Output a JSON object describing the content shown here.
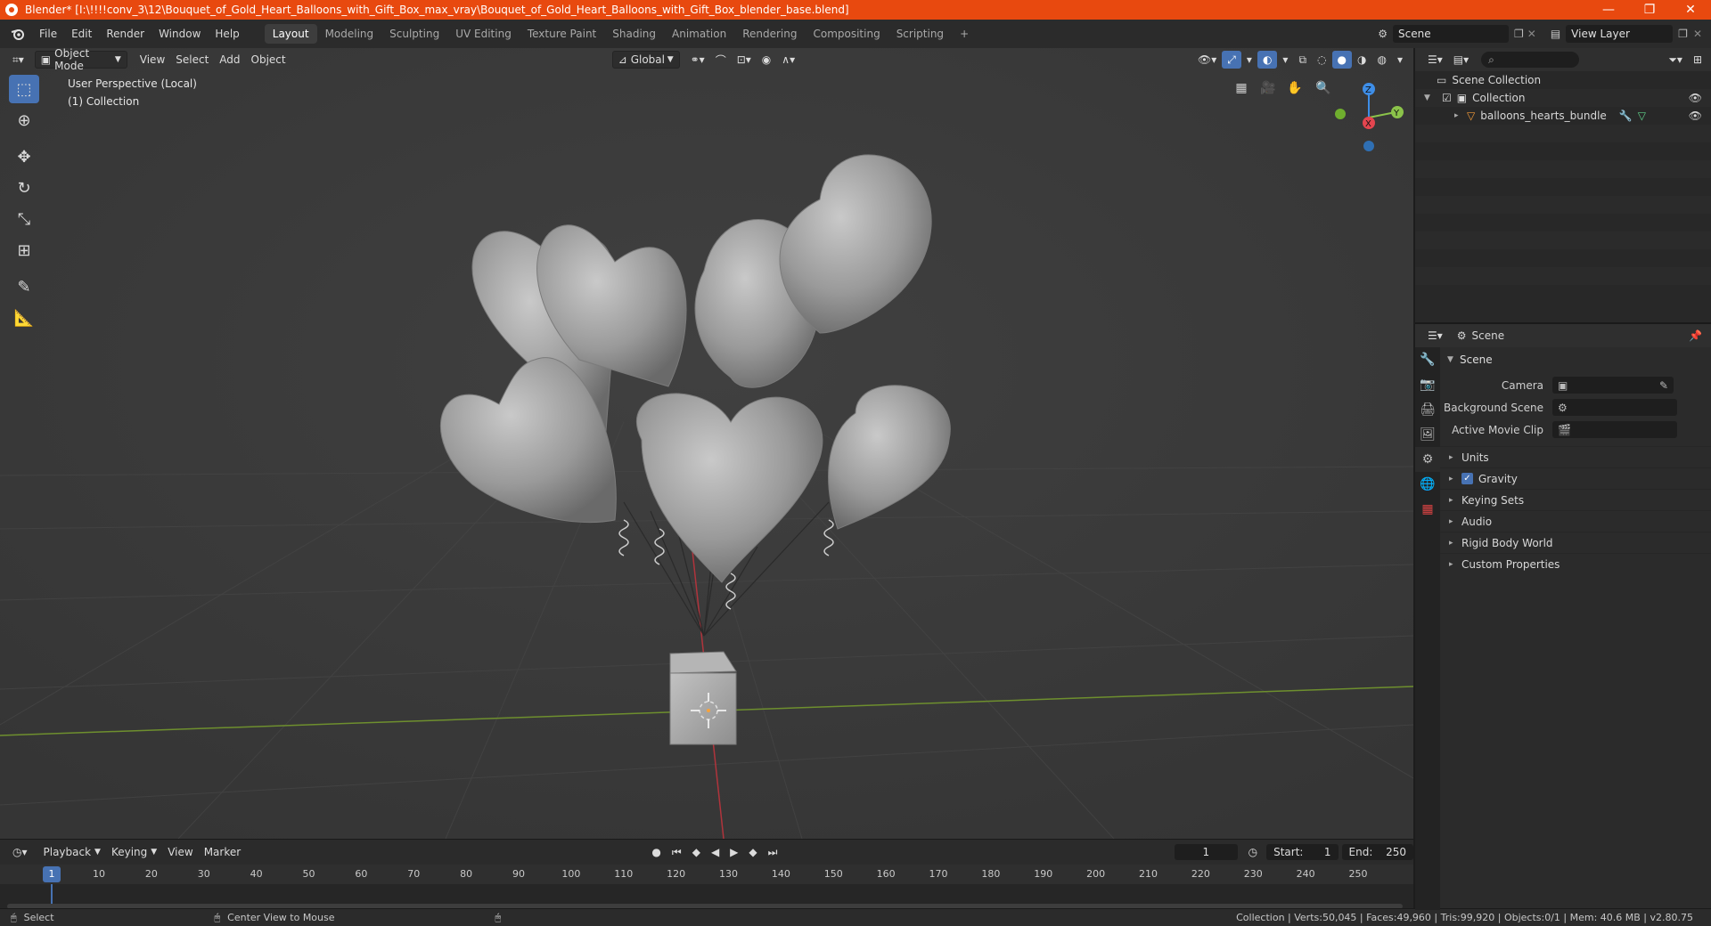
{
  "window": {
    "title": "Blender* [I:\\!!!!conv_3\\12\\Bouquet_of_Gold_Heart_Balloons_with_Gift_Box_max_vray\\Bouquet_of_Gold_Heart_Balloons_with_Gift_Box_blender_base.blend]",
    "minimize": "—",
    "maximize": "❐",
    "close": "✕"
  },
  "menu": [
    "File",
    "Edit",
    "Render",
    "Window",
    "Help"
  ],
  "workspaces": [
    "Layout",
    "Modeling",
    "Sculpting",
    "UV Editing",
    "Texture Paint",
    "Shading",
    "Animation",
    "Rendering",
    "Compositing",
    "Scripting"
  ],
  "add_workspace": "+",
  "scene_name": "Scene",
  "view_layer": "View Layer",
  "viewport": {
    "mode": "Object Mode",
    "menus": [
      "View",
      "Select",
      "Add",
      "Object"
    ],
    "transform_orientation": "Global",
    "info_line1": "User Perspective (Local)",
    "info_line2": "(1) Collection",
    "axis_z": "Z",
    "axis_y": "Y",
    "axis_x": "X"
  },
  "timeline": {
    "menus": [
      "Playback",
      "Keying",
      "View",
      "Marker"
    ],
    "current_frame": "1",
    "start_label": "Start:",
    "start": "1",
    "end_label": "End:",
    "end": "250",
    "ticks": [
      "1",
      "10",
      "20",
      "30",
      "40",
      "50",
      "60",
      "70",
      "80",
      "90",
      "100",
      "110",
      "120",
      "130",
      "140",
      "150",
      "160",
      "170",
      "180",
      "190",
      "200",
      "210",
      "220",
      "230",
      "240",
      "250"
    ]
  },
  "status": {
    "select": "Select",
    "center_view": "Center View to Mouse",
    "stats": "Collection | Verts:50,045 | Faces:49,960 | Tris:99,920 | Objects:0/1 | Mem: 40.6 MB | v2.80.75"
  },
  "outliner": {
    "root": "Scene Collection",
    "collection": "Collection",
    "object": "balloons_hearts_bundle"
  },
  "properties": {
    "header": "Scene",
    "panel": "Scene",
    "camera_label": "Camera",
    "bg_scene_label": "Background Scene",
    "movie_clip_label": "Active Movie Clip",
    "subpanels": [
      "Units",
      "Gravity",
      "Keying Sets",
      "Audio",
      "Rigid Body World",
      "Custom Properties"
    ]
  },
  "colors": {
    "title_bar": "#e8490f",
    "accent": "#4772b3",
    "x_axis": "#e4454f",
    "y_axis": "#8bc34a",
    "z_axis": "#3e8ee8"
  }
}
